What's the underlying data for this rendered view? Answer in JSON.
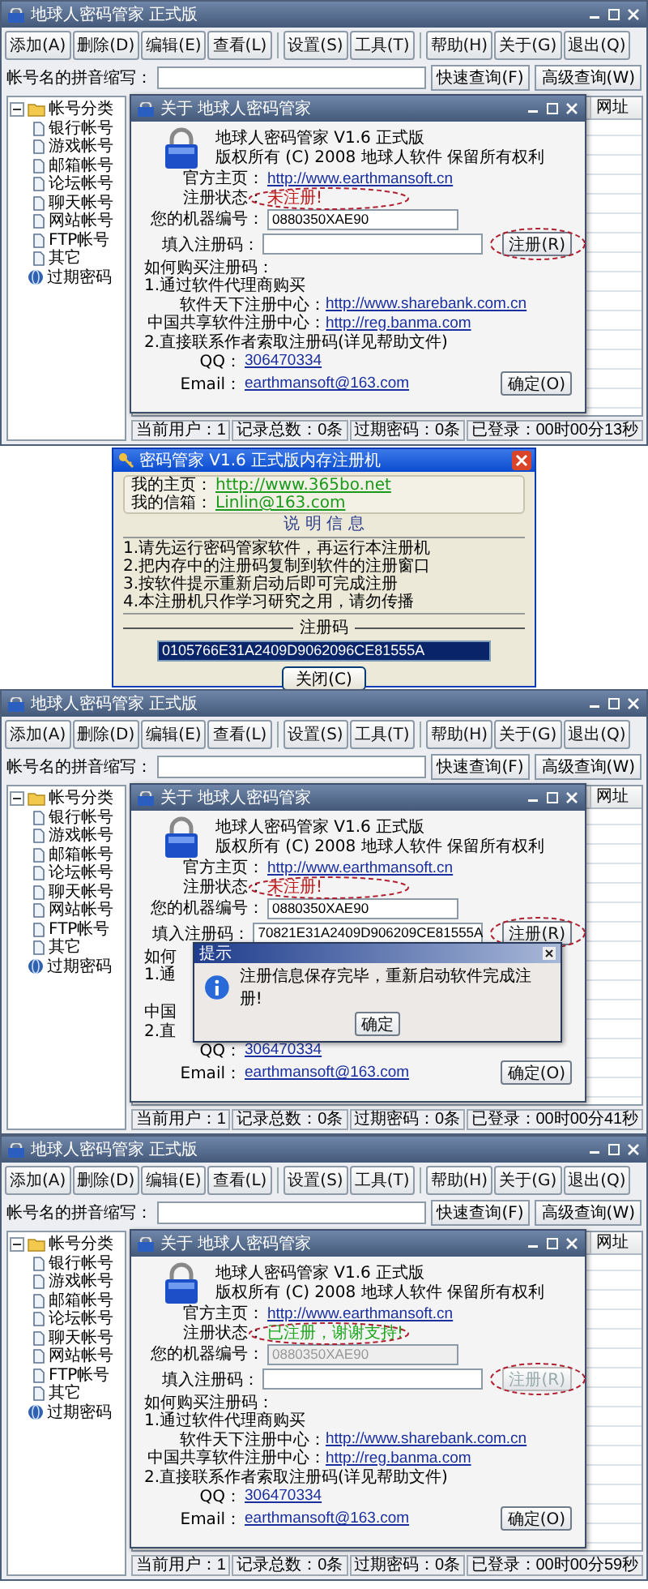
{
  "screens": [
    {
      "kind": "main_window",
      "window": {
        "title": "地球人密码管家 正式版"
      },
      "toolbar": [
        [
          "添加(A)",
          "删除(D)",
          "编辑(E)",
          "查看(L)"
        ],
        [
          "设置(S)",
          "工具(T)"
        ],
        [
          "帮助(H)",
          "关于(G)",
          "退出(Q)"
        ]
      ],
      "search": {
        "label": "帐号名的拼音缩写：",
        "buttons": [
          "快速查询(F)",
          "高级查询(W)"
        ]
      },
      "tree": [
        {
          "label": "帐号分类",
          "expanded": true,
          "children": [
            {
              "label": "银行帐号"
            },
            {
              "label": "游戏帐号"
            },
            {
              "label": "邮箱帐号"
            },
            {
              "label": "论坛帐号"
            },
            {
              "label": "聊天帐号"
            },
            {
              "label": "网站帐号"
            },
            {
              "label": "FTP帐号"
            },
            {
              "label": "其它"
            }
          ]
        },
        {
          "label": "过期密码"
        }
      ],
      "table": {
        "columns": [
          "网址"
        ]
      },
      "status_bar": [
        "当前用户：1",
        "记录总数：0条",
        "过期密码：0条",
        "已登录：00时00分13秒"
      ],
      "dialog": {
        "title": "关于 地球人密码管家",
        "product": "地球人密码管家 V1.6 正式版",
        "copyright": "版权所有 (C) 2008 地球人软件 保留所有权利",
        "homepage_label": "官方主页：",
        "homepage_url": "http://www.earthmansoft.cn",
        "status_label": "注册状态：",
        "status": "未注册!",
        "registered": false,
        "machine_label": "您的机器编号：",
        "machine_id": "0880350XAE90",
        "code_label": "填入注册码：",
        "register_button": {
          "label": "注册(R)",
          "disabled": false
        },
        "purchase": [
          {
            "kind": "heading",
            "text": "如何购买注册码："
          },
          {
            "kind": "step",
            "text": "1.通过软件代理商购买"
          },
          {
            "kind": "link",
            "label": "软件天下注册中心：",
            "url": "http://www.sharebank.com.cn"
          },
          {
            "kind": "link",
            "label": "中国共享软件注册中心：",
            "url": "http://reg.banma.com"
          },
          {
            "kind": "step",
            "text": "2.直接联系作者索取注册码(详见帮助文件)"
          }
        ],
        "qq_label": "QQ：",
        "qq": "306470334",
        "email_label": "Email：",
        "email": "earthmansoft@163.com",
        "ok_button": "确定(O)",
        "circled": true
      }
    },
    {
      "kind": "keygen",
      "title": "密码管家 V1.6 正式版内存注册机",
      "homepage_label": "我的主页：",
      "homepage": "http://www.365bo.net",
      "email_label": "我的信箱：",
      "email": "Linlin@163.com",
      "info_title": "说 明 信 息",
      "info_lines": [
        "1.请先运行密码管家软件，再运行本注册机",
        "2.把内存中的注册码复制到软件的注册窗口",
        "3.按软件提示重新启动后即可完成注册",
        "4.本注册机只作学习研究之用，请勿传播"
      ],
      "code_label": "注册码",
      "code": "0105766E31A2409D9062096CE81555A",
      "close_button": "关闭(C)"
    },
    {
      "kind": "main_window",
      "window": {
        "title": "地球人密码管家 正式版"
      },
      "toolbar": [
        [
          "添加(A)",
          "删除(D)",
          "编辑(E)",
          "查看(L)"
        ],
        [
          "设置(S)",
          "工具(T)"
        ],
        [
          "帮助(H)",
          "关于(G)",
          "退出(Q)"
        ]
      ],
      "search": {
        "label": "帐号名的拼音缩写：",
        "buttons": [
          "快速查询(F)",
          "高级查询(W)"
        ]
      },
      "tree": [
        {
          "label": "帐号分类",
          "expanded": true,
          "children": [
            {
              "label": "银行帐号"
            },
            {
              "label": "游戏帐号"
            },
            {
              "label": "邮箱帐号"
            },
            {
              "label": "论坛帐号"
            },
            {
              "label": "聊天帐号"
            },
            {
              "label": "网站帐号"
            },
            {
              "label": "FTP帐号"
            },
            {
              "label": "其它"
            }
          ]
        },
        {
          "label": "过期密码"
        }
      ],
      "table": {
        "columns": [
          "网址"
        ]
      },
      "status_bar": [
        "当前用户：1",
        "记录总数：0条",
        "过期密码：0条",
        "已登录：00时00分41秒"
      ],
      "dialog": {
        "title": "关于 地球人密码管家",
        "product": "地球人密码管家 V1.6 正式版",
        "copyright": "版权所有 (C) 2008 地球人软件 保留所有权利",
        "homepage_label": "官方主页：",
        "homepage_url": "http://www.earthmansoft.cn",
        "status_label": "注册状态：",
        "status": "未注册!",
        "registered": false,
        "machine_label": "您的机器编号：",
        "machine_id": "0880350XAE90",
        "code_label": "填入注册码：",
        "code": "70821E31A2409D906209CE81555A",
        "register_button": {
          "label": "注册(R)",
          "disabled": false
        },
        "purchase": [
          {
            "kind": "fragment",
            "text": "如何"
          },
          {
            "kind": "fragment",
            "text": "1.通"
          },
          {
            "kind": "covered"
          },
          {
            "kind": "fragment",
            "text": "中国"
          },
          {
            "kind": "fragment",
            "text": "2.直"
          }
        ],
        "qq_label": "QQ：",
        "qq": "306470334",
        "email_label": "Email：",
        "email": "earthmansoft@163.com",
        "ok_button": "确定(O)",
        "circled": true
      },
      "message_box": {
        "title": "提示",
        "text": "注册信息保存完毕，重新启动软件完成注册!",
        "button": "确定"
      }
    },
    {
      "kind": "main_window",
      "window": {
        "title": "地球人密码管家 正式版"
      },
      "toolbar": [
        [
          "添加(A)",
          "删除(D)",
          "编辑(E)",
          "查看(L)"
        ],
        [
          "设置(S)",
          "工具(T)"
        ],
        [
          "帮助(H)",
          "关于(G)",
          "退出(Q)"
        ]
      ],
      "search": {
        "label": "帐号名的拼音缩写：",
        "buttons": [
          "快速查询(F)",
          "高级查询(W)"
        ]
      },
      "tree": [
        {
          "label": "帐号分类",
          "expanded": true,
          "children": [
            {
              "label": "银行帐号"
            },
            {
              "label": "游戏帐号"
            },
            {
              "label": "邮箱帐号"
            },
            {
              "label": "论坛帐号"
            },
            {
              "label": "聊天帐号"
            },
            {
              "label": "网站帐号"
            },
            {
              "label": "FTP帐号"
            },
            {
              "label": "其它"
            }
          ]
        },
        {
          "label": "过期密码"
        }
      ],
      "table": {
        "columns": [
          "网址"
        ]
      },
      "status_bar": [
        "当前用户：1",
        "记录总数：0条",
        "过期密码：0条",
        "已登录：00时00分59秒"
      ],
      "dialog": {
        "title": "关于 地球人密码管家",
        "product": "地球人密码管家 V1.6 正式版",
        "copyright": "版权所有 (C) 2008 地球人软件 保留所有权利",
        "homepage_label": "官方主页：",
        "homepage_url": "http://www.earthmansoft.cn",
        "status_label": "注册状态：",
        "status": "已注册，谢谢支持!",
        "registered": true,
        "machine_label": "您的机器编号：",
        "machine_id": "0880350XAE90",
        "code_label": "填入注册码：",
        "register_button": {
          "label": "注册(R)",
          "disabled": true
        },
        "purchase": [
          {
            "kind": "heading",
            "text": "如何购买注册码："
          },
          {
            "kind": "step",
            "text": "1.通过软件代理商购买"
          },
          {
            "kind": "link",
            "label": "软件天下注册中心：",
            "url": "http://www.sharebank.com.cn"
          },
          {
            "kind": "link",
            "label": "中国共享软件注册中心：",
            "url": "http://reg.banma.com"
          },
          {
            "kind": "step",
            "text": "2.直接联系作者索取注册码(详见帮助文件)"
          }
        ],
        "qq_label": "QQ：",
        "qq": "306470334",
        "email_label": "Email：",
        "email": "earthmansoft@163.com",
        "ok_button": "确定(O)",
        "circled": true
      }
    }
  ]
}
